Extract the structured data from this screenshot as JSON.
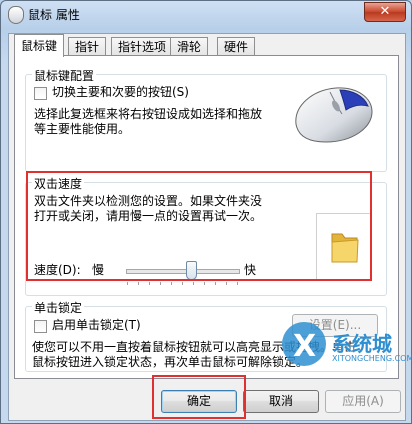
{
  "window": {
    "title": "鼠标 属性",
    "close_glyph": "✕"
  },
  "tabs": [
    "鼠标键",
    "指针",
    "指针选项",
    "滑轮",
    "硬件"
  ],
  "button_config": {
    "legend": "鼠标键配置",
    "switch_label": "切换主要和次要的按钮(S)",
    "desc_line1": "选择此复选框来将右按钮设成如选择和拖放",
    "desc_line2": "等主要性能使用。"
  },
  "double_click": {
    "legend": "双击速度",
    "desc_line1": "双击文件夹以检测您的设置。如果文件夹没",
    "desc_line2": "打开或关闭，请用慢一点的设置再试一次。",
    "speed_label": "速度(D):",
    "slow_label": "慢",
    "fast_label": "快",
    "speed_level": 0.58
  },
  "click_lock": {
    "legend": "单击锁定",
    "enable_label": "启用单击锁定(T)",
    "settings_button": "设置(E)...",
    "desc_line1": "使您可以不用一直按着鼠标按钮就可以高亮显示或拖拽。单击",
    "desc_line2": "鼠标按钮进入锁定状态，再次单击鼠标可解除锁定。"
  },
  "footer": {
    "ok": "确定",
    "cancel": "取消",
    "apply": "应用(A)"
  },
  "watermark": {
    "brand": "系统城",
    "url": "XITONGCHENG.COM"
  },
  "colors": {
    "highlight_box": "#e03030",
    "folder": "#f1c84b",
    "brand": "#2f8fd1"
  }
}
